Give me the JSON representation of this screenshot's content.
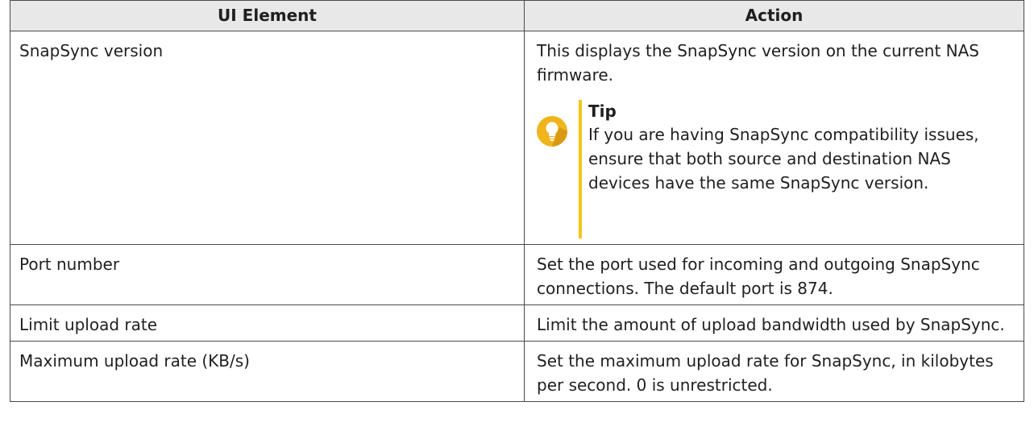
{
  "table": {
    "headers": {
      "col1": "UI Element",
      "col2": "Action"
    },
    "rows": [
      {
        "element": "SnapSync version",
        "action": "This displays the SnapSync version on the current NAS firmware.",
        "tip": {
          "icon": "lightbulb-icon",
          "title": "Tip",
          "text": "If you are having SnapSync compatibility issues, ensure that both source and destination NAS devices have the same SnapSync version."
        }
      },
      {
        "element": "Port number",
        "action": "Set the port used for incoming and outgoing SnapSync connections. The default port is 874."
      },
      {
        "element": "Limit upload rate",
        "action": "Limit the amount of upload bandwidth used by SnapSync."
      },
      {
        "element": "Maximum upload rate (KB/s)",
        "action": "Set the maximum upload rate for SnapSync, in kilobytes per second. 0 is unrestricted."
      }
    ]
  },
  "colors": {
    "header_bg": "#e8e8e8",
    "border": "#4a4a4a",
    "tip_accent": "#f5c518",
    "tip_icon_bg": "#f0b41c"
  }
}
